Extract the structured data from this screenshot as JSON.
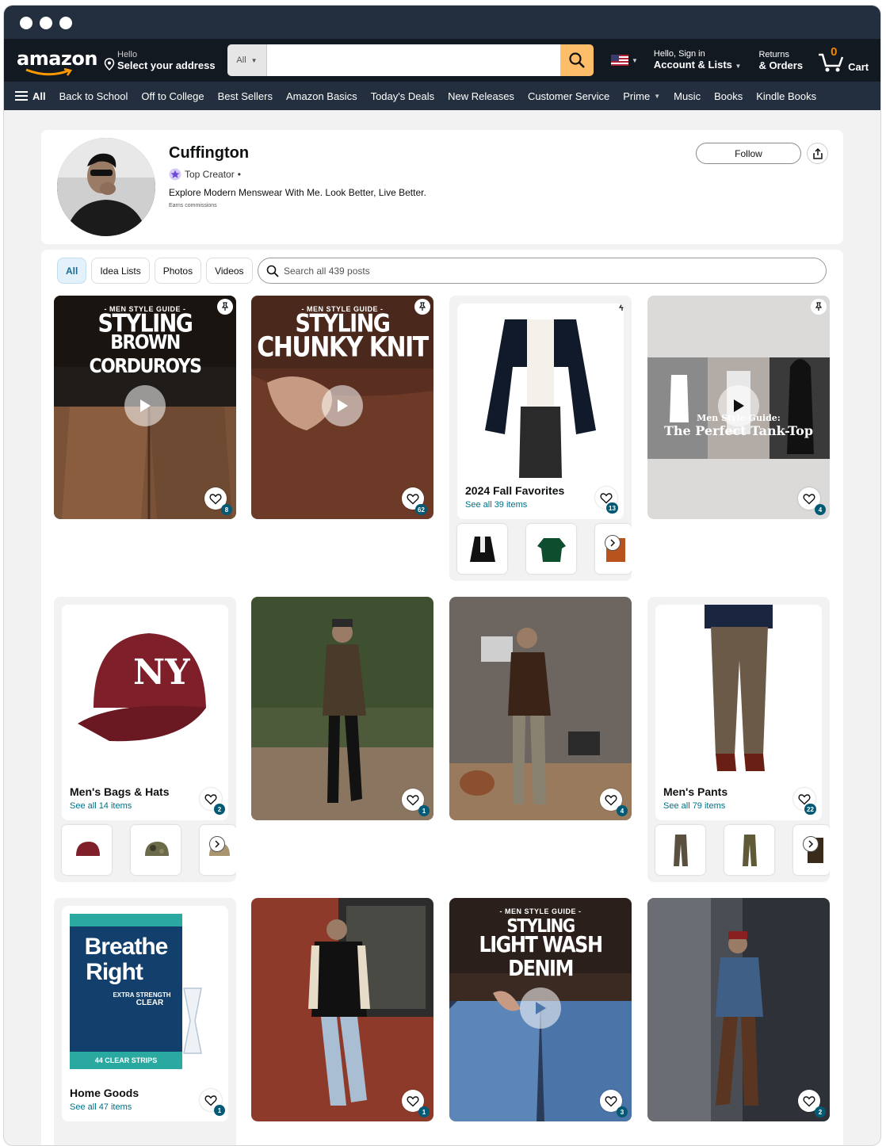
{
  "nav": {
    "logo": "amazon",
    "deliver_hello": "Hello",
    "deliver_address": "Select your address",
    "search_category": "All",
    "account_hello": "Hello, Sign in",
    "account_lists": "Account & Lists",
    "returns": "Returns",
    "orders": "& Orders",
    "cart_count": "0",
    "cart_label": "Cart"
  },
  "subnav": {
    "all": "All",
    "items": [
      "Back to School",
      "Off to College",
      "Best Sellers",
      "Amazon Basics",
      "Today's Deals",
      "New Releases",
      "Customer Service",
      "Prime",
      "Music",
      "Books",
      "Kindle Books"
    ]
  },
  "profile": {
    "name": "Cuffington",
    "badge": "Top Creator",
    "bio": "Explore Modern Menswear With Me. Look Better, Live Better.",
    "earns": "Earns commissions",
    "follow": "Follow"
  },
  "feed": {
    "tabs": [
      "All",
      "Idea Lists",
      "Photos",
      "Videos"
    ],
    "search_placeholder": "Search all 439 posts"
  },
  "cards": [
    {
      "guide_small": "- MEN STYLE GUIDE -",
      "guide_l1": "STYLING",
      "guide_l2": "BROWN CORDUROYS",
      "count": "8"
    },
    {
      "guide_small": "- MEN STYLE GUIDE -",
      "guide_l1": "STYLING",
      "guide_l2": "CHUNKY KNIT",
      "count": "62"
    },
    {
      "title": "2024 Fall Favorites",
      "sub": "See all 39 items",
      "count": "13"
    },
    {
      "overlay_l1": "Men Style Guide:",
      "overlay_l2": "The Perfect Tank-Top",
      "count": "4"
    },
    {
      "title": "Men's Bags & Hats",
      "sub": "See all 14 items",
      "count": "2"
    },
    {
      "count": "1"
    },
    {
      "count": "4"
    },
    {
      "title": "Men's Pants",
      "sub": "See all 79 items",
      "count": "22"
    },
    {
      "title": "Home Goods",
      "sub": "See all 47 items",
      "count": "1",
      "box_l1": "Breathe",
      "box_l2": "Right",
      "box_l3": "EXTRA STRENGTH",
      "box_l4": "CLEAR",
      "box_l5": "44 CLEAR STRIPS"
    },
    {
      "count": "1"
    },
    {
      "guide_small": "- MEN STYLE GUIDE -",
      "guide_l1": "STYLING",
      "guide_l2": "LIGHT WASH DENIM",
      "count": "3"
    },
    {
      "count": "2"
    }
  ]
}
